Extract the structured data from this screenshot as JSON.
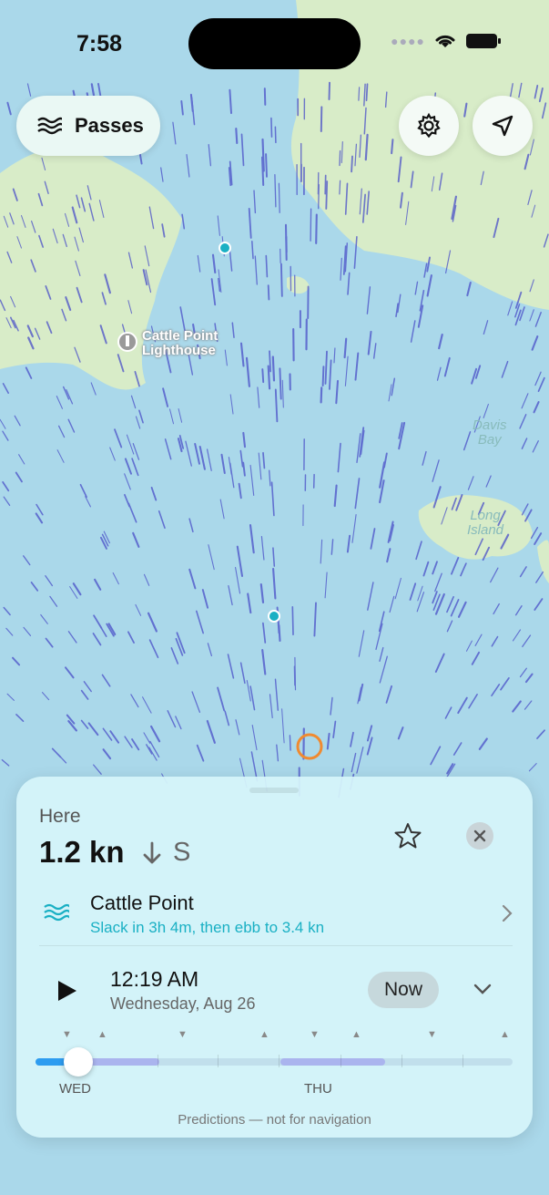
{
  "status_bar": {
    "time": "7:58"
  },
  "top_controls": {
    "passes_label": "Passes",
    "settings_icon": "gear-icon",
    "locate_icon": "location-arrow-icon"
  },
  "map": {
    "labels": {
      "lighthouse_line1": "Cattle Point",
      "lighthouse_line2": "Lighthouse",
      "davis_line1": "Davis",
      "davis_line2": "Bay",
      "long_line1": "Long",
      "long_line2": "Island"
    },
    "colors": {
      "water": "#aad8ea",
      "land": "#d8ecc8",
      "current": "#4a4fc8",
      "station": "#1ab0c4",
      "selection": "#f08a30"
    }
  },
  "panel": {
    "here_label": "Here",
    "speed": "1.2 kn",
    "direction": "S",
    "station_name": "Cattle Point",
    "station_status": "Slack in 3h 4m, then ebb to 3.4 kn",
    "time": "12:19 AM",
    "date": "Wednesday, Aug 26",
    "now_label": "Now",
    "day_labels": [
      "WED",
      "THU"
    ],
    "timeline_progress_pct": 9,
    "footer": "Predictions — not for navigation"
  }
}
